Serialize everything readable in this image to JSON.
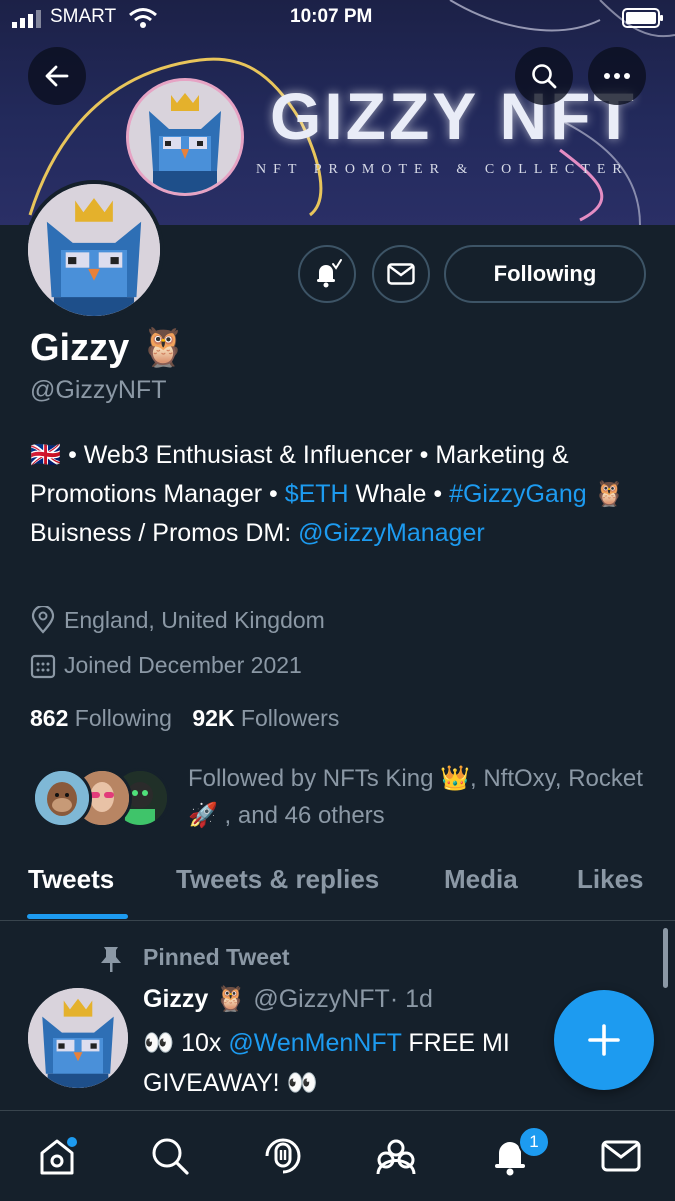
{
  "status_bar": {
    "carrier": "SMART",
    "time": "10:07 PM"
  },
  "banner": {
    "title": "GIZZY NFT",
    "subtitle": "NFT PROMOTER & COLLECTER"
  },
  "profile": {
    "display_name": "Gizzy 🦉",
    "handle": "@GizzyNFT",
    "following_button": "Following",
    "bio": {
      "flag": "🇬🇧",
      "part1": " • Web3 Enthusiast & Influencer • Marketing & Promotions Manager • ",
      "cashtag": "$ETH",
      "part2": " Whale • ",
      "hashtag": "#GizzyGang",
      "part3": " 🦉 Buisness / Promos DM: ",
      "mention": "@GizzyManager"
    },
    "location": "England, United Kingdom",
    "joined": "Joined December 2021",
    "following_count": "862",
    "following_label": "Following",
    "followers_count": "92K",
    "followers_label": "Followers",
    "followed_by": "Followed by NFTs King 👑, NftOxy, Rocket 🚀 , and 46 others"
  },
  "tabs": [
    "Tweets",
    "Tweets & replies",
    "Media",
    "Likes"
  ],
  "pinned_tweet": {
    "label": "Pinned Tweet",
    "author": "Gizzy 🦉",
    "handle": "@GizzyNFT",
    "time": "· 1d",
    "text_prefix": "👀 10x ",
    "mention": "@WenMenNFT",
    "text_suffix": " FREE MI",
    "line2": "GIVEAWAY! 👀"
  },
  "bottom_nav": {
    "items": [
      "home-icon",
      "search-icon",
      "spaces-icon",
      "communities-icon",
      "notifications-icon",
      "messages-icon"
    ],
    "notification_badge": "1"
  },
  "colors": {
    "background": "#15202b",
    "accent": "#1d9bf0",
    "secondary_text": "#8b98a5",
    "border": "#38444d"
  }
}
